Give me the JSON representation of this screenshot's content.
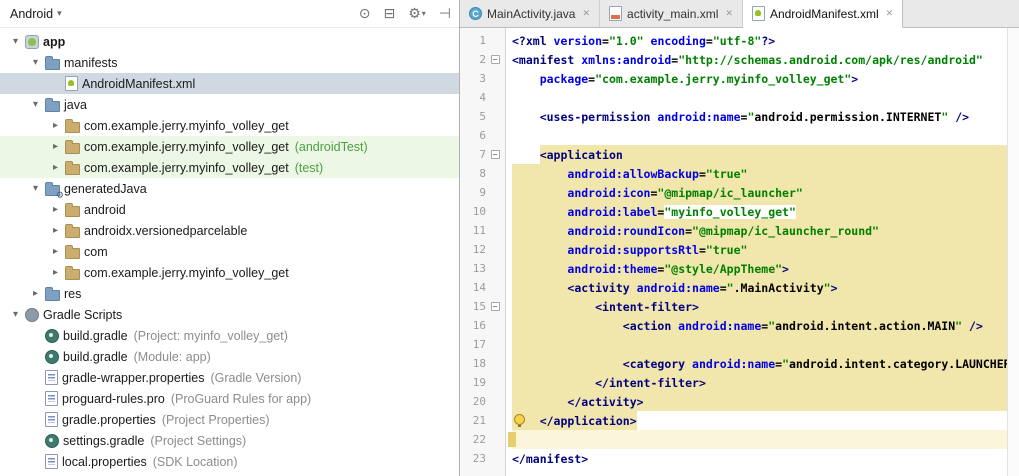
{
  "colors": {
    "highlight": "#F1E6AB",
    "caret_line": "#FBF5DC",
    "selection": "#D0D9E2",
    "green_row": "#EDF7E6",
    "annotation": "#8C8C8C",
    "annotation_green": "#4D9E44",
    "tag": "#000080",
    "attr": "#0000E6",
    "value": "#008000",
    "konst": "#000000"
  },
  "project_panel": {
    "view_selector": {
      "label": "Android",
      "dropdown_glyph": "▾"
    },
    "toolbar": {
      "icons": [
        {
          "name": "locate-file-icon",
          "glyph": "⊙"
        },
        {
          "name": "collapse-all-icon",
          "glyph": "⊟"
        },
        {
          "name": "settings-gear-icon",
          "glyph": "⚙",
          "dropdown": true
        },
        {
          "name": "hide-panel-icon",
          "glyph": "⊣"
        }
      ]
    },
    "tree": [
      {
        "label": "app",
        "level": 0,
        "arrow": "down",
        "icon": "app-module",
        "bold": true
      },
      {
        "label": "manifests",
        "level": 1,
        "arrow": "down",
        "icon": "folder"
      },
      {
        "label": "AndroidManifest.xml",
        "level": 2,
        "arrow": "none",
        "icon": "manifest-file",
        "selected": true
      },
      {
        "label": "java",
        "level": 1,
        "arrow": "down",
        "icon": "folder"
      },
      {
        "label": "com.example.jerry.myinfo_volley_get",
        "level": 2,
        "arrow": "right",
        "icon": "package"
      },
      {
        "label": "com.example.jerry.myinfo_volley_get",
        "annotation": "(androidTest)",
        "annotation_color": "green",
        "level": 2,
        "arrow": "right",
        "icon": "package",
        "rowbg": "green"
      },
      {
        "label": "com.example.jerry.myinfo_volley_get",
        "annotation": "(test)",
        "annotation_color": "green",
        "level": 2,
        "arrow": "right",
        "icon": "package",
        "rowbg": "green"
      },
      {
        "label": "generatedJava",
        "level": 1,
        "arrow": "down",
        "icon": "gen-folder"
      },
      {
        "label": "android",
        "level": 2,
        "arrow": "right",
        "icon": "package"
      },
      {
        "label": "androidx.versionedparcelable",
        "level": 2,
        "arrow": "right",
        "icon": "package"
      },
      {
        "label": "com",
        "level": 2,
        "arrow": "right",
        "icon": "package"
      },
      {
        "label": "com.example.jerry.myinfo_volley_get",
        "level": 2,
        "arrow": "right",
        "icon": "package"
      },
      {
        "label": "res",
        "level": 1,
        "arrow": "right",
        "icon": "folder"
      },
      {
        "label": "Gradle Scripts",
        "level": 0,
        "arrow": "down",
        "icon": "gradle"
      },
      {
        "label": "build.gradle",
        "annotation": "(Project: myinfo_volley_get)",
        "level": 1,
        "arrow": "none",
        "icon": "gradle-file"
      },
      {
        "label": "build.gradle",
        "annotation": "(Module: app)",
        "level": 1,
        "arrow": "none",
        "icon": "gradle-file"
      },
      {
        "label": "gradle-wrapper.properties",
        "annotation": "(Gradle Version)",
        "level": 1,
        "arrow": "none",
        "icon": "properties-file"
      },
      {
        "label": "proguard-rules.pro",
        "annotation": "(ProGuard Rules for app)",
        "level": 1,
        "arrow": "none",
        "icon": "properties-file"
      },
      {
        "label": "gradle.properties",
        "annotation": "(Project Properties)",
        "level": 1,
        "arrow": "none",
        "icon": "properties-file"
      },
      {
        "label": "settings.gradle",
        "annotation": "(Project Settings)",
        "level": 1,
        "arrow": "none",
        "icon": "gradle-file"
      },
      {
        "label": "local.properties",
        "annotation": "(SDK Location)",
        "level": 1,
        "arrow": "none",
        "icon": "properties-file"
      }
    ]
  },
  "editor": {
    "tabs": [
      {
        "label": "MainActivity.java",
        "icon": "java-class-file",
        "active": false
      },
      {
        "label": "activity_main.xml",
        "icon": "layout-file",
        "active": false
      },
      {
        "label": "AndroidManifest.xml",
        "icon": "manifest-file",
        "active": true
      }
    ],
    "close_glyph": "✕",
    "lines": [
      {
        "n": 1,
        "tokens": [
          [
            "t",
            "<?xml "
          ],
          [
            "a",
            "version"
          ],
          [
            "p",
            "="
          ],
          [
            "v",
            "\"1.0\""
          ],
          [
            "p",
            " "
          ],
          [
            "a",
            "encoding"
          ],
          [
            "p",
            "="
          ],
          [
            "v",
            "\"utf-8\""
          ],
          [
            "t",
            "?>"
          ]
        ]
      },
      {
        "n": 2,
        "fold": true,
        "tokens": [
          [
            "t",
            "<manifest "
          ],
          [
            "a",
            "xmlns:android"
          ],
          [
            "p",
            "="
          ],
          [
            "v",
            "\"http://schemas.android.com/apk/res/android\""
          ]
        ]
      },
      {
        "n": 3,
        "tokens": [
          [
            "p",
            "    "
          ],
          [
            "a",
            "package"
          ],
          [
            "p",
            "="
          ],
          [
            "v",
            "\"com.example.jerry.myinfo_volley_get\""
          ],
          [
            "t",
            ">"
          ]
        ]
      },
      {
        "n": 4,
        "tokens": []
      },
      {
        "n": 5,
        "tokens": [
          [
            "p",
            "    "
          ],
          [
            "t",
            "<uses-permission "
          ],
          [
            "a",
            "android:name"
          ],
          [
            "p",
            "="
          ],
          [
            "v",
            "\""
          ],
          [
            "k",
            "android.permission.INTERNET"
          ],
          [
            "v",
            "\""
          ],
          [
            "p",
            " "
          ],
          [
            "t",
            "/>"
          ]
        ]
      },
      {
        "n": 6,
        "tokens": []
      },
      {
        "n": 7,
        "fold": true,
        "hl": "start",
        "tokens": [
          [
            "p",
            "    "
          ],
          [
            "t",
            "<application"
          ]
        ]
      },
      {
        "n": 8,
        "hl": "full",
        "tokens": [
          [
            "p",
            "        "
          ],
          [
            "a",
            "android:allowBackup"
          ],
          [
            "p",
            "="
          ],
          [
            "v",
            "\"true\""
          ]
        ]
      },
      {
        "n": 9,
        "hl": "full",
        "tokens": [
          [
            "p",
            "        "
          ],
          [
            "a",
            "android:icon"
          ],
          [
            "p",
            "="
          ],
          [
            "v",
            "\"@mipmap/ic_launcher\""
          ]
        ]
      },
      {
        "n": 10,
        "hl": "full",
        "tokens": [
          [
            "p",
            "        "
          ],
          [
            "a",
            "android:label"
          ],
          [
            "p",
            "="
          ],
          [
            "o",
            "\"myinfo_volley_get\""
          ]
        ]
      },
      {
        "n": 11,
        "hl": "full",
        "tokens": [
          [
            "p",
            "        "
          ],
          [
            "a",
            "android:roundIcon"
          ],
          [
            "p",
            "="
          ],
          [
            "v",
            "\"@mipmap/ic_launcher_round\""
          ]
        ]
      },
      {
        "n": 12,
        "hl": "full",
        "tokens": [
          [
            "p",
            "        "
          ],
          [
            "a",
            "android:supportsRtl"
          ],
          [
            "p",
            "="
          ],
          [
            "v",
            "\"true\""
          ]
        ]
      },
      {
        "n": 13,
        "hl": "full",
        "tokens": [
          [
            "p",
            "        "
          ],
          [
            "a",
            "android:theme"
          ],
          [
            "p",
            "="
          ],
          [
            "v",
            "\"@style/AppTheme\""
          ],
          [
            "t",
            ">"
          ]
        ]
      },
      {
        "n": 14,
        "hl": "full",
        "tokens": [
          [
            "p",
            "        "
          ],
          [
            "t",
            "<activity "
          ],
          [
            "a",
            "android:name"
          ],
          [
            "p",
            "="
          ],
          [
            "v",
            "\""
          ],
          [
            "k",
            ".MainActivity"
          ],
          [
            "v",
            "\""
          ],
          [
            "t",
            ">"
          ]
        ]
      },
      {
        "n": 15,
        "fold": true,
        "hl": "full",
        "tokens": [
          [
            "p",
            "            "
          ],
          [
            "t",
            "<intent-filter>"
          ]
        ]
      },
      {
        "n": 16,
        "hl": "full",
        "tokens": [
          [
            "p",
            "                "
          ],
          [
            "t",
            "<action "
          ],
          [
            "a",
            "android:name"
          ],
          [
            "p",
            "="
          ],
          [
            "v",
            "\""
          ],
          [
            "k",
            "android.intent.action.MAIN"
          ],
          [
            "v",
            "\""
          ],
          [
            "p",
            " "
          ],
          [
            "t",
            "/>"
          ]
        ]
      },
      {
        "n": 17,
        "hl": "full",
        "tokens": []
      },
      {
        "n": 18,
        "hl": "full",
        "tokens": [
          [
            "p",
            "                "
          ],
          [
            "t",
            "<category "
          ],
          [
            "a",
            "android:name"
          ],
          [
            "p",
            "="
          ],
          [
            "v",
            "\""
          ],
          [
            "k",
            "android.intent.category.LAUNCHER"
          ],
          [
            "v",
            "\""
          ],
          [
            "p",
            " "
          ],
          [
            "t",
            "/>"
          ]
        ]
      },
      {
        "n": 19,
        "hl": "full",
        "tokens": [
          [
            "p",
            "            "
          ],
          [
            "t",
            "</intent-filter>"
          ]
        ]
      },
      {
        "n": 20,
        "hl": "full",
        "tokens": [
          [
            "p",
            "        "
          ],
          [
            "t",
            "</activity>"
          ]
        ]
      },
      {
        "n": 21,
        "hl": "end",
        "bulb": true,
        "tokens": [
          [
            "p",
            "    "
          ],
          [
            "t",
            "</application>"
          ]
        ]
      },
      {
        "n": 22,
        "caret": true,
        "tokens": []
      },
      {
        "n": 23,
        "tokens": [
          [
            "t",
            "</manifest>"
          ]
        ]
      }
    ]
  }
}
